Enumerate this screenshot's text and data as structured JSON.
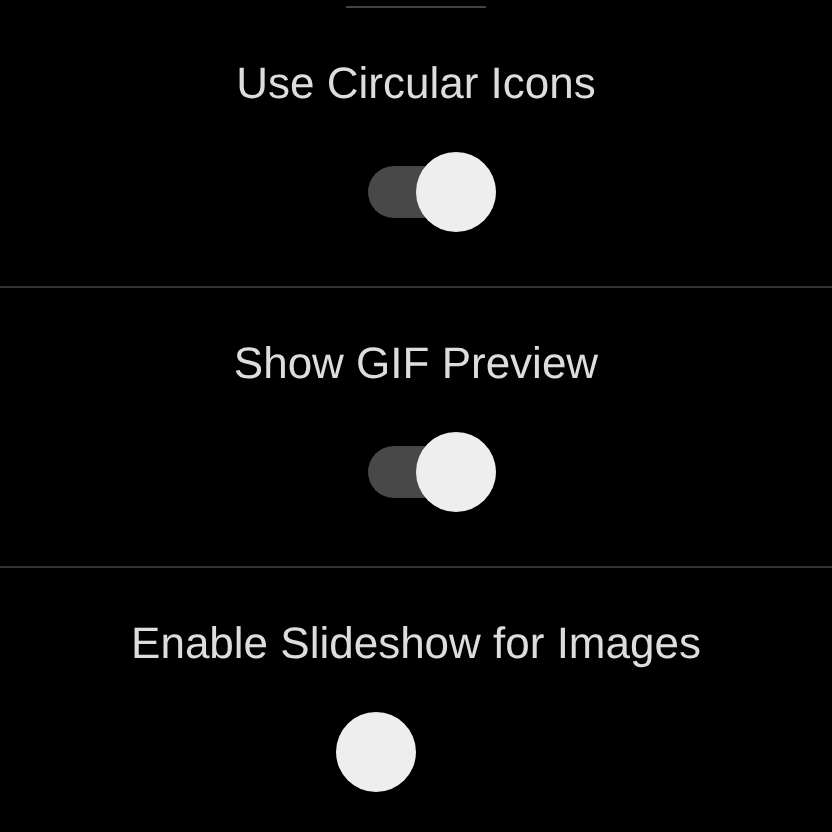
{
  "settings": [
    {
      "label": "Use Circular Icons",
      "on": true
    },
    {
      "label": "Show GIF Preview",
      "on": true
    },
    {
      "label": "Enable Slideshow for Images",
      "on": false
    }
  ]
}
